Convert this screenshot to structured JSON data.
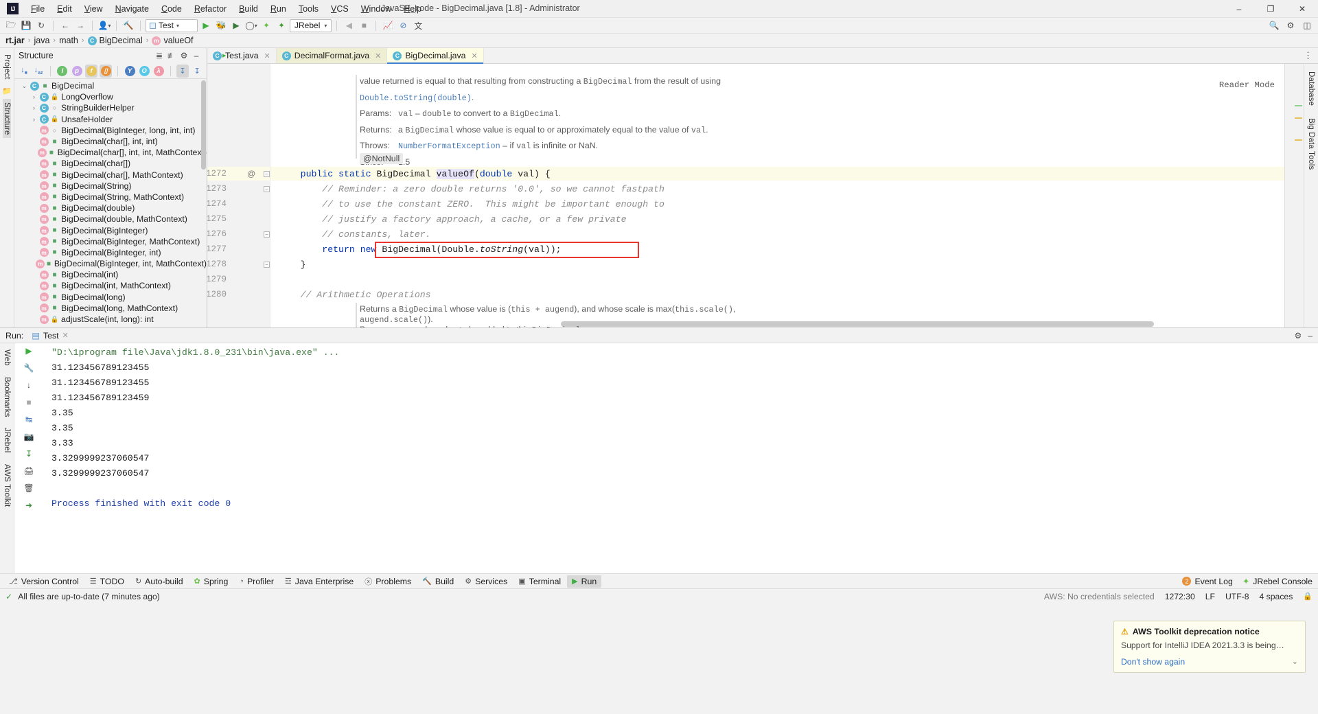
{
  "title_bar": {
    "window_title": "JavaSE_code - BigDecimal.java [1.8] - Administrator",
    "logo": "IJ",
    "menu": [
      "File",
      "Edit",
      "View",
      "Navigate",
      "Code",
      "Refactor",
      "Build",
      "Run",
      "Tools",
      "VCS",
      "Window",
      "Help"
    ],
    "controls": {
      "minimize": "–",
      "maximize": "❐",
      "close": "✕"
    }
  },
  "toolbar": {
    "run_config": "Test",
    "jrebel": "JRebel",
    "icons": [
      "open-folder-icon",
      "save-icon",
      "sync-icon",
      "back-arrow-icon",
      "forward-arrow-icon",
      "profile-icon",
      "build-hammer-icon"
    ],
    "right_icons": [
      "search-icon",
      "settings-gear-icon",
      "layout-icon"
    ]
  },
  "breadcrumb": {
    "items": [
      {
        "label": "rt.jar",
        "icon": "jar-icon",
        "bold": true
      },
      {
        "label": "java",
        "icon": "package-icon",
        "bold": false
      },
      {
        "label": "math",
        "icon": "package-icon",
        "bold": false
      },
      {
        "label": "BigDecimal",
        "icon": "class-icon",
        "bold": false
      },
      {
        "label": "valueOf",
        "icon": "method-icon",
        "bold": false
      }
    ]
  },
  "left_strip": {
    "labels": [
      "Project",
      "Structure"
    ],
    "selected": "Structure"
  },
  "right_strip": {
    "labels": [
      "Database",
      "Big Data Tools"
    ]
  },
  "structure": {
    "title": "Structure",
    "header_icons": [
      "expand-all-icon",
      "collapse-all-icon",
      "settings-gear-icon",
      "hide-icon"
    ],
    "toolbar_icons": [
      {
        "name": "sort-by-visibility-icon",
        "glyph": "↓",
        "active": false
      },
      {
        "name": "sort-alphabetically-icon",
        "glyph": "↓",
        "active": false
      },
      {
        "name": "show-inherited-icon",
        "glyph": "I",
        "active": false
      },
      {
        "name": "show-properties-icon",
        "glyph": "p",
        "active": false
      },
      {
        "name": "show-fields-icon",
        "glyph": "f",
        "active": true
      },
      {
        "name": "show-non-public-icon",
        "glyph": "▯",
        "active": true
      },
      {
        "name": "show-anonymous-icon",
        "glyph": "Y",
        "active": false
      },
      {
        "name": "group-implementations-icon",
        "glyph": "O",
        "active": false
      },
      {
        "name": "show-lambdas-icon",
        "glyph": "λ",
        "active": false
      },
      {
        "name": "autoscroll-to-source-icon",
        "glyph": "↧",
        "active": true
      },
      {
        "name": "autoscroll-from-source-icon",
        "glyph": "↧",
        "active": false
      }
    ],
    "tree": [
      {
        "label": "BigDecimal",
        "depth": 0,
        "twisty": "⌄",
        "icon": "class-icon",
        "vis": "package"
      },
      {
        "label": "LongOverflow",
        "depth": 1,
        "twisty": "›",
        "icon": "class-icon",
        "vis": "private"
      },
      {
        "label": "StringBuilderHelper",
        "depth": 1,
        "twisty": "›",
        "icon": "class-icon",
        "vis": "protected"
      },
      {
        "label": "UnsafeHolder",
        "depth": 1,
        "twisty": "›",
        "icon": "class-icon",
        "vis": "private"
      },
      {
        "label": "BigDecimal(BigInteger, long, int, int)",
        "depth": 1,
        "twisty": "",
        "icon": "method-icon",
        "vis": "protected"
      },
      {
        "label": "BigDecimal(char[], int, int)",
        "depth": 1,
        "twisty": "",
        "icon": "method-icon",
        "vis": "package"
      },
      {
        "label": "BigDecimal(char[], int, int, MathContext)",
        "depth": 1,
        "twisty": "",
        "icon": "method-icon",
        "vis": "package"
      },
      {
        "label": "BigDecimal(char[])",
        "depth": 1,
        "twisty": "",
        "icon": "method-icon",
        "vis": "package"
      },
      {
        "label": "BigDecimal(char[], MathContext)",
        "depth": 1,
        "twisty": "",
        "icon": "method-icon",
        "vis": "package"
      },
      {
        "label": "BigDecimal(String)",
        "depth": 1,
        "twisty": "",
        "icon": "method-icon",
        "vis": "package"
      },
      {
        "label": "BigDecimal(String, MathContext)",
        "depth": 1,
        "twisty": "",
        "icon": "method-icon",
        "vis": "package"
      },
      {
        "label": "BigDecimal(double)",
        "depth": 1,
        "twisty": "",
        "icon": "method-icon",
        "vis": "package"
      },
      {
        "label": "BigDecimal(double, MathContext)",
        "depth": 1,
        "twisty": "",
        "icon": "method-icon",
        "vis": "package"
      },
      {
        "label": "BigDecimal(BigInteger)",
        "depth": 1,
        "twisty": "",
        "icon": "method-icon",
        "vis": "package"
      },
      {
        "label": "BigDecimal(BigInteger, MathContext)",
        "depth": 1,
        "twisty": "",
        "icon": "method-icon",
        "vis": "package"
      },
      {
        "label": "BigDecimal(BigInteger, int)",
        "depth": 1,
        "twisty": "",
        "icon": "method-icon",
        "vis": "package"
      },
      {
        "label": "BigDecimal(BigInteger, int, MathContext)",
        "depth": 1,
        "twisty": "",
        "icon": "method-icon",
        "vis": "package"
      },
      {
        "label": "BigDecimal(int)",
        "depth": 1,
        "twisty": "",
        "icon": "method-icon",
        "vis": "package"
      },
      {
        "label": "BigDecimal(int, MathContext)",
        "depth": 1,
        "twisty": "",
        "icon": "method-icon",
        "vis": "package"
      },
      {
        "label": "BigDecimal(long)",
        "depth": 1,
        "twisty": "",
        "icon": "method-icon",
        "vis": "package"
      },
      {
        "label": "BigDecimal(long, MathContext)",
        "depth": 1,
        "twisty": "",
        "icon": "method-icon",
        "vis": "package"
      },
      {
        "label": "adjustScale(int, long): int",
        "depth": 1,
        "twisty": "",
        "icon": "method-icon",
        "vis": "private"
      }
    ]
  },
  "editor": {
    "tabs": [
      {
        "label": "Test.java",
        "icon": "java-run-class-icon",
        "state": "plain"
      },
      {
        "label": "DecimalFormat.java",
        "icon": "java-class-icon",
        "state": "readonly"
      },
      {
        "label": "BigDecimal.java",
        "icon": "java-class-icon",
        "state": "active"
      }
    ],
    "reader_mode": "Reader Mode",
    "javadoc_top": [
      {
        "type": "text",
        "parts": [
          {
            "t": "value returned is equal to that resulting from constructing a ",
            "s": "lbl"
          },
          {
            "t": "BigDecimal",
            "s": "mono"
          },
          {
            "t": " from the result of using",
            "s": "lbl"
          }
        ]
      },
      {
        "type": "text",
        "parts": [
          {
            "t": "Double.toString(double)",
            "s": "lnk"
          },
          {
            "t": ".",
            "s": "lbl"
          }
        ]
      },
      {
        "type": "kv",
        "key": "Params:",
        "parts": [
          {
            "t": "val",
            "s": "mono"
          },
          {
            "t": " – ",
            "s": "lbl"
          },
          {
            "t": "double",
            "s": "mono"
          },
          {
            "t": " to convert to a ",
            "s": "lbl"
          },
          {
            "t": "BigDecimal",
            "s": "mono"
          },
          {
            "t": ".",
            "s": "lbl"
          }
        ]
      },
      {
        "type": "kv",
        "key": "Returns:",
        "parts": [
          {
            "t": "a ",
            "s": "lbl"
          },
          {
            "t": "BigDecimal",
            "s": "mono"
          },
          {
            "t": " whose value is equal to or approximately equal to the value of ",
            "s": "lbl"
          },
          {
            "t": "val",
            "s": "mono"
          },
          {
            "t": ".",
            "s": "lbl"
          }
        ]
      },
      {
        "type": "kv",
        "key": "Throws:",
        "parts": [
          {
            "t": "NumberFormatException",
            "s": "lnk"
          },
          {
            "t": " – if ",
            "s": "lbl"
          },
          {
            "t": "val",
            "s": "mono"
          },
          {
            "t": " is infinite or NaN.",
            "s": "lbl"
          }
        ]
      },
      {
        "type": "kv",
        "key": "Since:",
        "parts": [
          {
            "t": "1.5",
            "s": "lbl"
          }
        ]
      }
    ],
    "annotation": "@NotNull",
    "code_lines": [
      {
        "num": "1272",
        "ann": "@",
        "fold": "−",
        "highlighted": true,
        "tokens": [
          {
            "t": "    public ",
            "s": "kw"
          },
          {
            "t": "static ",
            "s": "kw"
          },
          {
            "t": "BigDecimal ",
            "s": ""
          },
          {
            "t": "valueOf",
            "s": "hl"
          },
          {
            "t": "(",
            "s": ""
          },
          {
            "t": "double",
            "s": "kw"
          },
          {
            "t": " val) {",
            "s": ""
          }
        ]
      },
      {
        "num": "1273",
        "ann": "",
        "fold": "−",
        "highlighted": false,
        "tokens": [
          {
            "t": "        // Reminder: a zero double returns '0.0', so we cannot fastpath",
            "s": "cmt"
          }
        ]
      },
      {
        "num": "1274",
        "ann": "",
        "fold": "",
        "highlighted": false,
        "tokens": [
          {
            "t": "        // to use the constant ZERO.  This might be important enough to",
            "s": "cmt"
          }
        ]
      },
      {
        "num": "1275",
        "ann": "",
        "fold": "",
        "highlighted": false,
        "tokens": [
          {
            "t": "        // justify a factory approach, a cache, or a few private",
            "s": "cmt"
          }
        ]
      },
      {
        "num": "1276",
        "ann": "",
        "fold": "−",
        "highlighted": false,
        "tokens": [
          {
            "t": "        // constants, later.",
            "s": "cmt"
          }
        ]
      },
      {
        "num": "1277",
        "ann": "",
        "fold": "",
        "highlighted": false,
        "boxed": true,
        "tokens": [
          {
            "t": "        return ",
            "s": "kw"
          },
          {
            "t": "new ",
            "s": "kw"
          },
          {
            "t": "BigDecimal(Double.",
            "s": ""
          },
          {
            "t": "toString",
            "s": "ital"
          },
          {
            "t": "(val));",
            "s": ""
          }
        ]
      },
      {
        "num": "1278",
        "ann": "",
        "fold": "−",
        "highlighted": false,
        "tokens": [
          {
            "t": "    }",
            "s": ""
          }
        ]
      },
      {
        "num": "1279",
        "ann": "",
        "fold": "",
        "highlighted": false,
        "tokens": []
      },
      {
        "num": "1280",
        "ann": "",
        "fold": "",
        "highlighted": false,
        "tokens": [
          {
            "t": "    // Arithmetic Operations",
            "s": "cmt"
          }
        ]
      }
    ],
    "javadoc_bottom": [
      {
        "type": "text",
        "parts": [
          {
            "t": "Returns a ",
            "s": "lbl"
          },
          {
            "t": "BigDecimal",
            "s": "mono"
          },
          {
            "t": " whose value is (",
            "s": "lbl"
          },
          {
            "t": "this + augend",
            "s": "mono"
          },
          {
            "t": "), and whose scale is max(",
            "s": "lbl"
          },
          {
            "t": "this.scale()",
            "s": "mono"
          },
          {
            "t": ",",
            "s": "lbl"
          }
        ]
      },
      {
        "type": "text",
        "parts": [
          {
            "t": "augend.scale()",
            "s": "mono"
          },
          {
            "t": ").",
            "s": "lbl"
          }
        ]
      },
      {
        "type": "kv",
        "key": "Params:",
        "parts": [
          {
            "t": "augend",
            "s": "mono"
          },
          {
            "t": " – value to be added to this ",
            "s": "lbl"
          },
          {
            "t": "BigDecimal",
            "s": "mono"
          },
          {
            "t": ".",
            "s": "lbl"
          }
        ]
      }
    ]
  },
  "run_panel": {
    "title": "Run:",
    "tab_label": "Test",
    "left_icons": [
      "run-icon",
      "wrench-icon",
      "stop-icon",
      "rerun-icon",
      "camera-icon",
      "print-icon",
      "export-icon",
      "trash-icon"
    ],
    "header_right_icons": [
      "settings-gear-icon",
      "hide-icon"
    ],
    "gutter_icons": [
      "rerun-icon",
      "scroll-down-icon",
      "soft-wrap-icon",
      "scroll-to-end-icon",
      "print-icon",
      "clear-all-icon",
      "up-icon"
    ],
    "output": [
      {
        "text": "\"D:\\1program file\\Java\\jdk1.8.0_231\\bin\\java.exe\" ...",
        "style": "cmd"
      },
      {
        "text": "31.123456789123455",
        "style": "plain"
      },
      {
        "text": "31.123456789123455",
        "style": "plain"
      },
      {
        "text": "31.123456789123459",
        "style": "plain"
      },
      {
        "text": "3.35",
        "style": "plain"
      },
      {
        "text": "3.35",
        "style": "plain"
      },
      {
        "text": "3.33",
        "style": "plain"
      },
      {
        "text": "3.3299999237060547",
        "style": "plain"
      },
      {
        "text": "3.3299999237060547",
        "style": "plain"
      },
      {
        "text": "",
        "style": "plain"
      },
      {
        "text": "Process finished with exit code 0",
        "style": "fin"
      }
    ]
  },
  "notification": {
    "title": "AWS Toolkit deprecation notice",
    "body": "Support for IntelliJ IDEA 2021.3.3 is being…",
    "link": "Don't show again",
    "icon": "warning-triangle-icon",
    "chevron": "⌄"
  },
  "bottom_bar": {
    "items": [
      {
        "label": "Version Control",
        "icon": "branch-icon",
        "active": false
      },
      {
        "label": "TODO",
        "icon": "checklist-icon",
        "active": false
      },
      {
        "label": "Auto-build",
        "icon": "refresh-icon",
        "active": false
      },
      {
        "label": "Spring",
        "icon": "spring-leaf-icon",
        "active": false
      },
      {
        "label": "Profiler",
        "icon": "gauge-icon",
        "active": false
      },
      {
        "label": "Java Enterprise",
        "icon": "enterprise-icon",
        "active": false
      },
      {
        "label": "Problems",
        "icon": "problems-icon",
        "active": false
      },
      {
        "label": "Build",
        "icon": "hammer-icon",
        "active": false
      },
      {
        "label": "Services",
        "icon": "services-icon",
        "active": false
      },
      {
        "label": "Terminal",
        "icon": "terminal-icon",
        "active": false
      },
      {
        "label": "Run",
        "icon": "run-icon",
        "active": true
      }
    ],
    "right": {
      "event_log": "Event Log",
      "jrebel_console": "JRebel Console",
      "event_badge": "2"
    }
  },
  "status_bar": {
    "message": "All files are up-to-date (7 minutes ago)",
    "icon": "check-icon",
    "caret_position": "1272:30",
    "line_separator": "LF",
    "encoding": "UTF-8",
    "indent": "4 spaces",
    "aws_label": "AWS: No credentials selected",
    "lock_icon": "lock-icon"
  },
  "left_toolwindows": [
    "Web",
    "Bookmarks",
    "JRebel",
    "AWS Toolkit"
  ]
}
